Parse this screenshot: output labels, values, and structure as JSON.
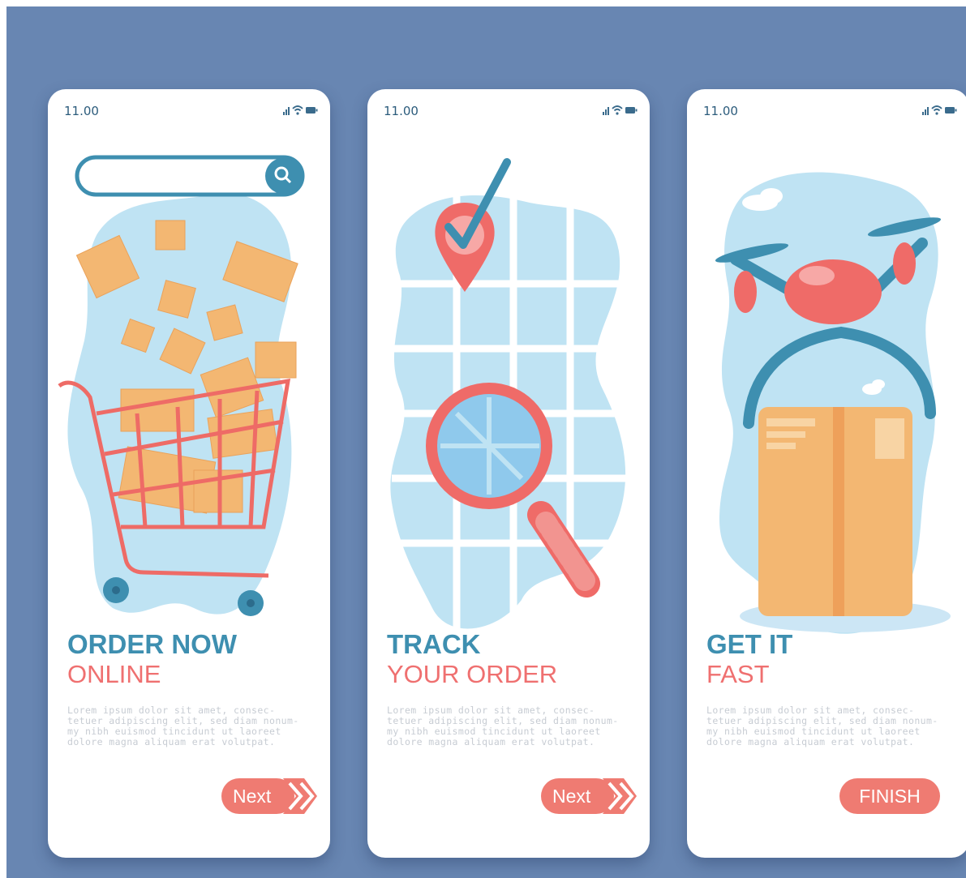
{
  "screens": [
    {
      "time": "11.00",
      "title_line1": "ORDER NOW",
      "title_line2": "ONLINE",
      "body": "Lorem ipsum dolor sit amet, consec-\ntetuer adipiscing elit, sed diam nonum-\nmy nibh euismod tincidunt ut laoreet\ndolore magna aliquam erat volutpat.",
      "button_label": "Next"
    },
    {
      "time": "11.00",
      "title_line1": "TRACK",
      "title_line2": "YOUR ORDER",
      "body": "Lorem ipsum dolor sit amet, consec-\ntetuer adipiscing elit, sed diam nonum-\nmy nibh euismod tincidunt ut laoreet\ndolore magna aliquam erat volutpat.",
      "button_label": "Next"
    },
    {
      "time": "11.00",
      "title_line1": "GET IT",
      "title_line2": "FAST",
      "body": "Lorem ipsum dolor sit amet, consec-\ntetuer adipiscing elit, sed diam nonum-\nmy nibh euismod tincidunt ut laoreet\ndolore magna aliquam erat volutpat.",
      "button_label": "FINISH"
    }
  ],
  "colors": {
    "background": "#6886b2",
    "title_blue": "#3e8fb0",
    "title_coral": "#ef7070",
    "button": "#ef7b72",
    "blob": "#bfe3f3",
    "box": "#f3b772",
    "cart": "#ee6b66"
  },
  "icons": [
    "signal-icon",
    "wifi-icon",
    "battery-icon",
    "search-icon",
    "location-pin-icon",
    "check-icon",
    "magnifier-icon",
    "drone-icon",
    "package-icon",
    "cloud-icon",
    "chevron-right-icon"
  ]
}
